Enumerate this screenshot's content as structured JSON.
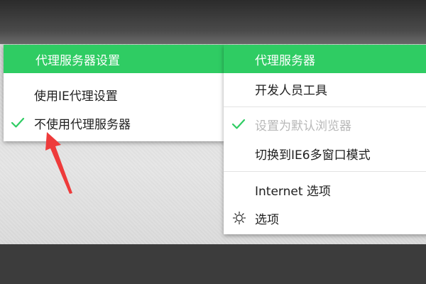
{
  "colors": {
    "accent": "#2fcc63",
    "menu_bg": "#ffffff",
    "disabled_text": "#b8b8b8",
    "annotation_arrow": "#ee3b3b"
  },
  "left_menu": {
    "header": "代理服务器设置",
    "items": [
      {
        "label": "使用IE代理设置",
        "checked": false
      },
      {
        "label": "不使用代理服务器",
        "checked": true,
        "check_icon": "check-icon"
      }
    ]
  },
  "right_menu": {
    "header": "代理服务器",
    "items": [
      {
        "label": "开发人员工具"
      },
      {
        "label": "设置为默认浏览器",
        "checked": true,
        "disabled": true,
        "check_icon": "check-icon"
      },
      {
        "label": "切换到IE6多窗口模式"
      },
      {
        "label": "Internet 选项"
      },
      {
        "label": "选项",
        "icon": "gear-icon"
      }
    ]
  },
  "annotation": {
    "icon": "red-arrow-icon"
  }
}
